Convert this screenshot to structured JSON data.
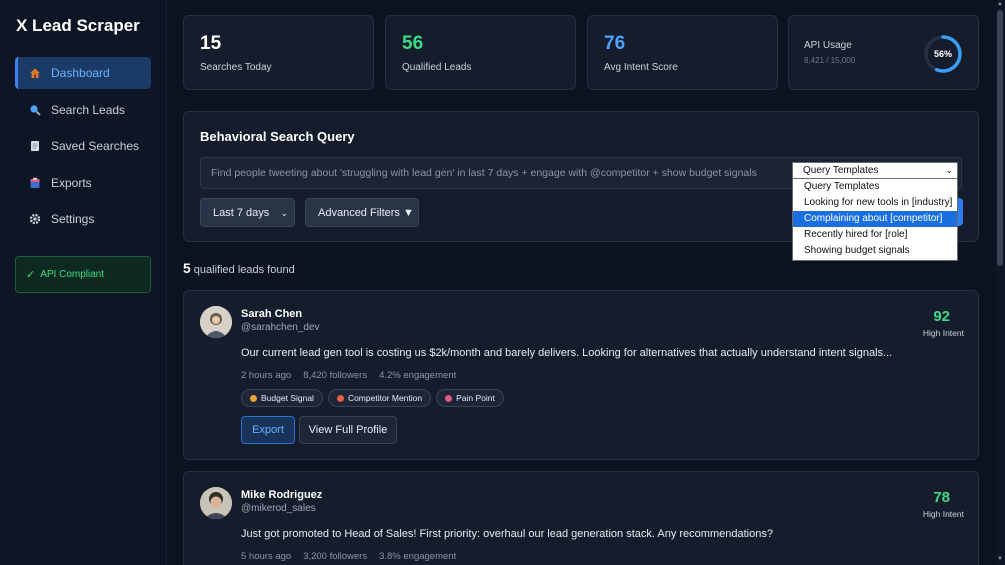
{
  "app": {
    "title": "X Lead Scraper"
  },
  "sidebar": {
    "items": [
      {
        "label": "Dashboard",
        "icon": "home-icon",
        "color": "#d9782f"
      },
      {
        "label": "Search Leads",
        "icon": "search-icon",
        "color": "#4da3ff"
      },
      {
        "label": "Saved Searches",
        "icon": "document-icon",
        "color": "#c9d1d9"
      },
      {
        "label": "Exports",
        "icon": "clipboard-icon",
        "color": "#e05a7a"
      },
      {
        "label": "Settings",
        "icon": "gear-icon",
        "color": "#c9d1d9"
      }
    ],
    "compliance": {
      "check": "✓",
      "label": "API Compliant"
    }
  },
  "stats": [
    {
      "value": "15",
      "label": "Searches Today",
      "color": "#ffffff"
    },
    {
      "value": "56",
      "label": "Qualified Leads",
      "color": "#3ddc84"
    },
    {
      "value": "76",
      "label": "Avg Intent Score",
      "color": "#4da3ff"
    }
  ],
  "api_usage": {
    "label": "API Usage",
    "detail": "8,421 / 15,000",
    "percent_text": "56%",
    "fraction": 0.56
  },
  "query": {
    "title": "Behavioral Search Query",
    "placeholder": "Find people tweeting about 'struggling with lead gen' in last 7 days + engage with @competitor + show budget signals",
    "timeframe": "Last 7 days",
    "advanced": "Advanced Filters ▼",
    "templates": {
      "selected": "Query Templates",
      "options": [
        "Query Templates",
        "Looking for new tools in [industry]",
        "Complaining about [competitor]",
        "Recently hired for [role]",
        "Showing budget signals"
      ],
      "highlighted_index": 2
    }
  },
  "results": {
    "count": "5",
    "label": "qualified leads found"
  },
  "leads": [
    {
      "name": "Sarah Chen",
      "handle": "@sarahchen_dev",
      "text": "Our current lead gen tool is costing us $2k/month and barely delivers. Looking for alternatives that actually understand intent signals...",
      "time": "2 hours ago",
      "followers": "8,420 followers",
      "engagement": "4.2% engagement",
      "score": "92",
      "score_label": "High Intent",
      "tags": [
        {
          "label": "Budget Signal",
          "color": "#e8a33d"
        },
        {
          "label": "Competitor Mention",
          "color": "#e8603d"
        },
        {
          "label": "Pain Point",
          "color": "#e05a7a"
        }
      ],
      "export_label": "Export",
      "profile_label": "View Full Profile"
    },
    {
      "name": "Mike Rodriguez",
      "handle": "@mikerod_sales",
      "text": "Just got promoted to Head of Sales! First priority: overhaul our lead generation stack. Any recommendations?",
      "time": "5 hours ago",
      "followers": "3,200 followers",
      "engagement": "3.8% engagement",
      "score": "78",
      "score_label": "High Intent"
    }
  ]
}
